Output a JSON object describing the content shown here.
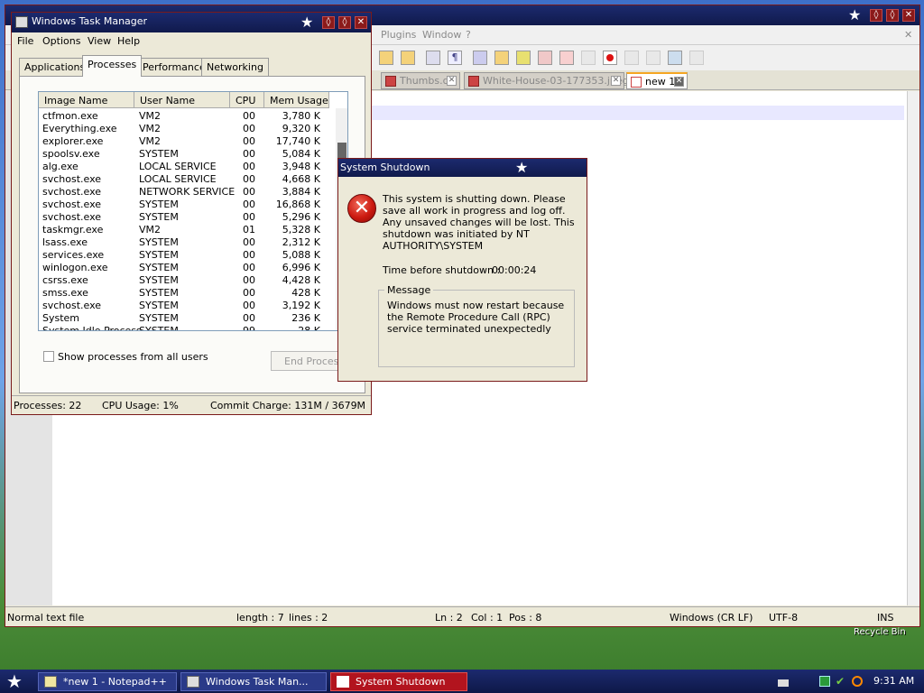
{
  "notepad": {
    "menu": [
      "Plugins",
      "Window",
      "?"
    ],
    "tabs": [
      {
        "label": "Thumbs.db"
      },
      {
        "label": "White-House-03-177353.jpeg"
      },
      {
        "label": "new 1"
      }
    ],
    "status": {
      "filetype": "Normal text file",
      "length": "length : 7",
      "lines": "lines : 2",
      "ln": "Ln : 2",
      "col": "Col : 1",
      "pos": "Pos : 8",
      "eol": "Windows (CR LF)",
      "encoding": "UTF-8",
      "mode": "INS"
    }
  },
  "taskmanager": {
    "title": "Windows Task Manager",
    "menu": [
      "File",
      "Options",
      "View",
      "Help"
    ],
    "tabs": [
      "Applications",
      "Processes",
      "Performance",
      "Networking"
    ],
    "columns": [
      "Image Name",
      "User Name",
      "CPU",
      "Mem Usage"
    ],
    "rows": [
      [
        "ctfmon.exe",
        "VM2",
        "00",
        "3,780 K"
      ],
      [
        "Everything.exe",
        "VM2",
        "00",
        "9,320 K"
      ],
      [
        "explorer.exe",
        "VM2",
        "00",
        "17,740 K"
      ],
      [
        "spoolsv.exe",
        "SYSTEM",
        "00",
        "5,084 K"
      ],
      [
        "alg.exe",
        "LOCAL SERVICE",
        "00",
        "3,948 K"
      ],
      [
        "svchost.exe",
        "LOCAL SERVICE",
        "00",
        "4,668 K"
      ],
      [
        "svchost.exe",
        "NETWORK SERVICE",
        "00",
        "3,884 K"
      ],
      [
        "svchost.exe",
        "SYSTEM",
        "00",
        "16,868 K"
      ],
      [
        "svchost.exe",
        "SYSTEM",
        "00",
        "5,296 K"
      ],
      [
        "taskmgr.exe",
        "VM2",
        "01",
        "5,328 K"
      ],
      [
        "lsass.exe",
        "SYSTEM",
        "00",
        "2,312 K"
      ],
      [
        "services.exe",
        "SYSTEM",
        "00",
        "5,088 K"
      ],
      [
        "winlogon.exe",
        "SYSTEM",
        "00",
        "6,996 K"
      ],
      [
        "csrss.exe",
        "SYSTEM",
        "00",
        "4,428 K"
      ],
      [
        "smss.exe",
        "SYSTEM",
        "00",
        "428 K"
      ],
      [
        "svchost.exe",
        "SYSTEM",
        "00",
        "3,192 K"
      ],
      [
        "System",
        "SYSTEM",
        "00",
        "236 K"
      ],
      [
        "System Idle Process",
        "SYSTEM",
        "99",
        "28 K"
      ]
    ],
    "show_all_label": "Show processes from all users",
    "end_process_label": "End Process",
    "status": {
      "processes": "Processes: 22",
      "cpu": "CPU Usage: 1%",
      "commit": "Commit Charge: 131M / 3679M"
    }
  },
  "shutdown": {
    "title": "System Shutdown",
    "message": "This system is shutting down. Please save all work in progress and log off. Any unsaved changes will be lost. This shutdown was initiated by NT AUTHORITY\\SYSTEM",
    "time_label": "Time before shutdown :",
    "time_value": "00:00:24",
    "group_label": "Message",
    "group_text": "Windows must now restart because the Remote Procedure Call (RPC) service terminated unexpectedly"
  },
  "taskbar": {
    "tasks": [
      "*new 1 - Notepad++",
      "Windows Task Man...",
      "System Shutdown"
    ],
    "clock": "9:31 AM"
  },
  "desktop": {
    "recycle_label": "Recycle Bin"
  },
  "colors": {
    "titlebar": "#101a4c",
    "close_button": "#8b1a1a",
    "active_task": "#b2141e",
    "error_icon": "#cc1a10"
  }
}
